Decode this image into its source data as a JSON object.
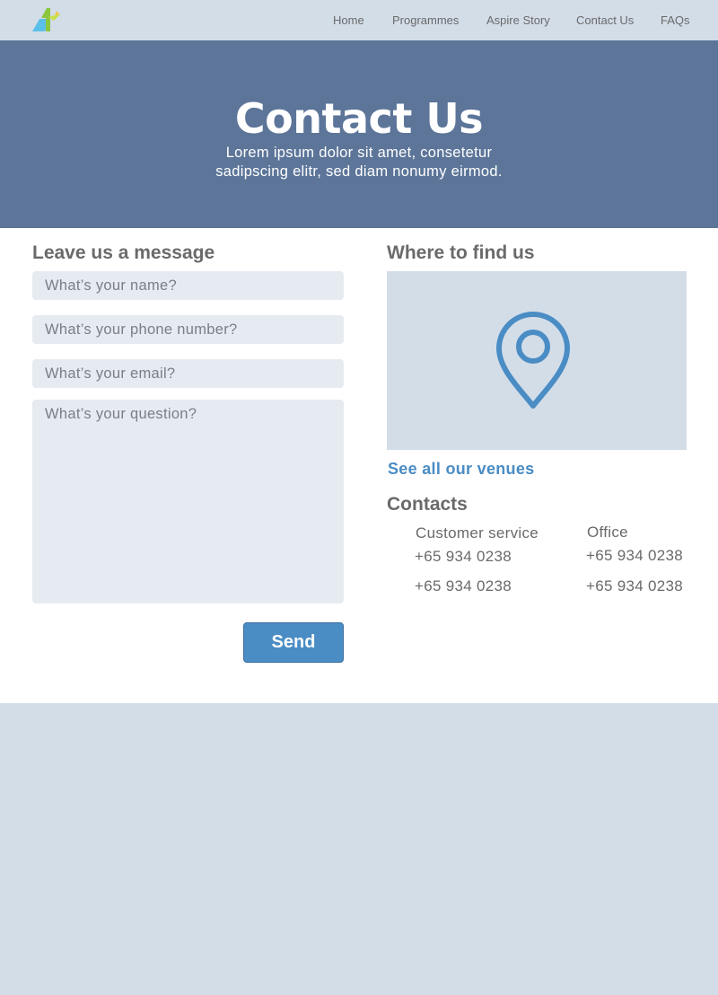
{
  "nav": {
    "logo": "aspire-logo",
    "links": [
      "Home",
      "Programmes",
      "Aspire Story",
      "Contact Us",
      "FAQs"
    ]
  },
  "hero": {
    "title": "Contact Us",
    "subtitle_line1": "Lorem ipsum dolor sit amet, consetetur",
    "subtitle_line2": "sadipscing elitr, sed diam nonumy eirmod."
  },
  "form": {
    "heading": "Leave us a message",
    "name_placeholder": "What’s your name?",
    "phone_placeholder": "What’s your phone number?",
    "email_placeholder": "What’s your email?",
    "question_placeholder": "What’s your question?",
    "send_label": "Send"
  },
  "location": {
    "heading": "Where to find us",
    "map_icon": "location-pin-icon",
    "venues_link": "See all our venues"
  },
  "contacts": {
    "heading": "Contacts",
    "customer_service": {
      "label": "Customer service",
      "phones": [
        "+65 934 0238",
        "+65 934 0238"
      ]
    },
    "office": {
      "label": "Office",
      "phones": [
        "+65 934 0238",
        "+65 934 0238"
      ]
    }
  },
  "colors": {
    "nav_bg": "#d3dde8",
    "hero_bg": "#5c7599",
    "accent": "#4a8cc4",
    "text": "#6a6a6a",
    "field_bg": "#e6ebf1"
  }
}
